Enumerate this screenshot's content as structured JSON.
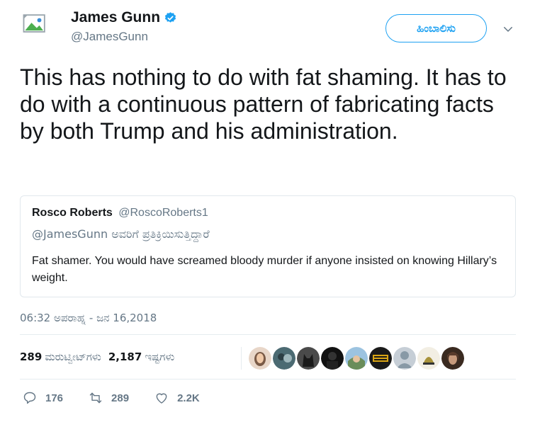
{
  "author": {
    "display_name": "James Gunn",
    "handle": "@JamesGunn",
    "verified": true
  },
  "follow_button_label": "ಹಿಂಬಾಲಿಸು",
  "tweet": {
    "text": "This has nothing to do with fat shaming. It has to do with a continuous pattern of fabricating facts by both Trump and his administration."
  },
  "quoted_tweet": {
    "author_name": "Rosco Roberts",
    "author_handle": "@RoscoRoberts1",
    "reply_to": "@JamesGunn ಅವರಿಗೆ ಪ್ರತಿಕ್ರಿಯಿಸುತ್ತಿದ್ದಾರೆ",
    "text": "Fat shamer. You would have screamed bloody murder if anyone insisted on knowing Hillary’s weight."
  },
  "timestamp": "06:32 ಅಪರಾಹ್ನ - ಜನ 16,2018",
  "stats": {
    "retweets_count": "289",
    "retweets_label": "ಮರುಟ್ವೀಟ್‌ಗಳು",
    "likes_count": "2,187",
    "likes_label": "ಇಷ್ಟಗಳು"
  },
  "likers": [
    {
      "icon": "liker-avatar-1",
      "color": "#7a5a46"
    },
    {
      "icon": "liker-avatar-2",
      "color": "#4b6a72"
    },
    {
      "icon": "liker-avatar-3",
      "color": "#2a2a2a"
    },
    {
      "icon": "liker-avatar-4",
      "color": "#111111"
    },
    {
      "icon": "liker-avatar-5",
      "color": "#6aa0c8"
    },
    {
      "icon": "liker-avatar-6",
      "color": "#d9a414"
    },
    {
      "icon": "liker-avatar-7",
      "color": "#c6ced6"
    },
    {
      "icon": "liker-avatar-8",
      "color": "#a8923a"
    },
    {
      "icon": "liker-avatar-9",
      "color": "#5a3c2c"
    }
  ],
  "actions": {
    "reply_count": "176",
    "retweet_count": "289",
    "like_count": "2.2K"
  },
  "colors": {
    "accent": "#1da1f2",
    "text_primary": "#14171a",
    "text_secondary": "#657786",
    "border": "#e1e8ed"
  }
}
